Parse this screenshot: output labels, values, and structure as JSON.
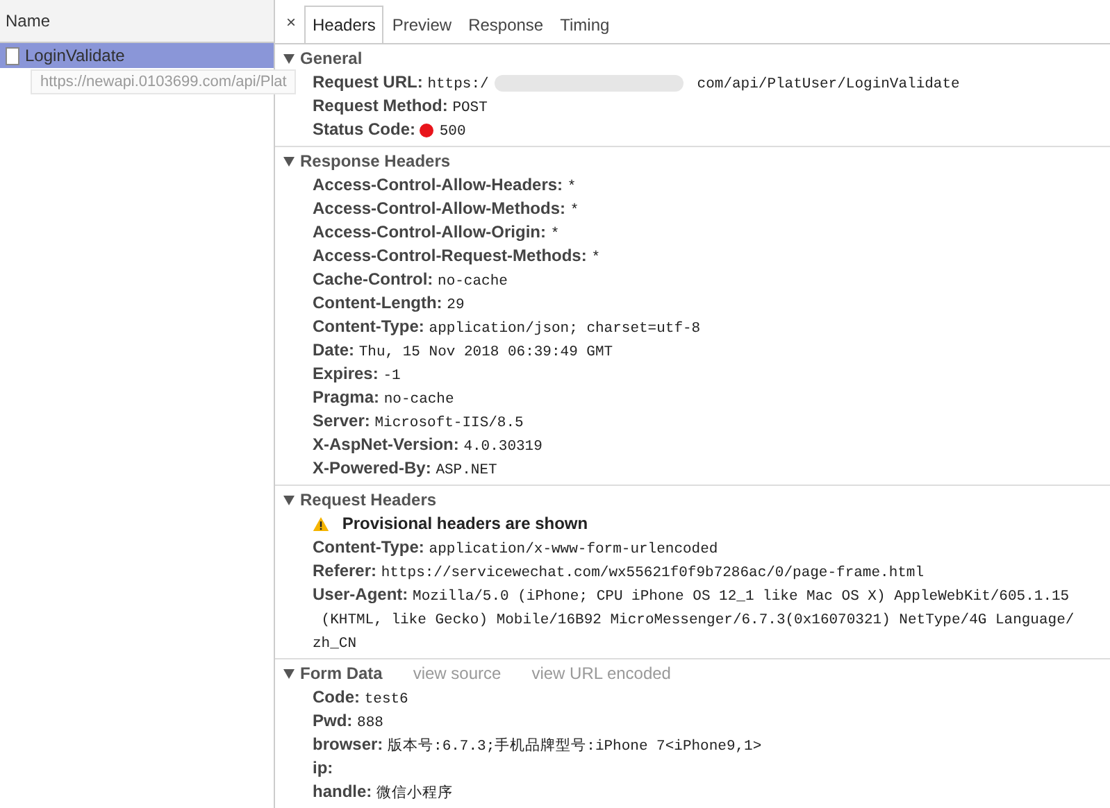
{
  "requests": {
    "column_header": "Name",
    "items": [
      {
        "name": "LoginValidate",
        "selected": true
      }
    ],
    "tooltip": "https://newapi.0103699.com/api/Plat"
  },
  "detail_tabs": {
    "close": "×",
    "tabs": [
      {
        "label": "Headers",
        "selected": true
      },
      {
        "label": "Preview",
        "selected": false
      },
      {
        "label": "Response",
        "selected": false
      },
      {
        "label": "Timing",
        "selected": false
      }
    ]
  },
  "sections": [
    {
      "title": "General",
      "expanded": true,
      "rows": [
        {
          "kind": "redacted",
          "label": "Request URL:",
          "value": "https:/",
          "value_end": "com/api/PlatUser/LoginValidate"
        },
        {
          "kind": "text",
          "label": "Request Method:",
          "value": "POST"
        },
        {
          "kind": "status",
          "label": "Status Code:",
          "value": "500",
          "color": "#e8141b"
        }
      ]
    },
    {
      "title": "Response Headers",
      "expanded": true,
      "rows": [
        {
          "kind": "text",
          "label": "Access-Control-Allow-Headers:",
          "value": "*"
        },
        {
          "kind": "text",
          "label": "Access-Control-Allow-Methods:",
          "value": "*"
        },
        {
          "kind": "text",
          "label": "Access-Control-Allow-Origin:",
          "value": "*"
        },
        {
          "kind": "text",
          "label": "Access-Control-Request-Methods:",
          "value": "*"
        },
        {
          "kind": "text",
          "label": "Cache-Control:",
          "value": "no-cache"
        },
        {
          "kind": "text",
          "label": "Content-Length:",
          "value": "29"
        },
        {
          "kind": "text",
          "label": "Content-Type:",
          "value": "application/json; charset=utf-8"
        },
        {
          "kind": "text",
          "label": "Date:",
          "value": "Thu, 15 Nov 2018 06:39:49 GMT"
        },
        {
          "kind": "text",
          "label": "Expires:",
          "value": "-1"
        },
        {
          "kind": "text",
          "label": "Pragma:",
          "value": "no-cache"
        },
        {
          "kind": "text",
          "label": "Server:",
          "value": "Microsoft-IIS/8.5"
        },
        {
          "kind": "text",
          "label": "X-AspNet-Version:",
          "value": "4.0.30319"
        },
        {
          "kind": "text",
          "label": "X-Powered-By:",
          "value": "ASP.NET"
        }
      ]
    },
    {
      "title": "Request Headers",
      "expanded": true,
      "rows": [
        {
          "kind": "warning",
          "label": "Provisional headers are shown"
        },
        {
          "kind": "text",
          "label": "Content-Type:",
          "value": "application/x-www-form-urlencoded"
        },
        {
          "kind": "text",
          "label": "Referer:",
          "value": "https://servicewechat.com/wx55621f0f9b7286ac/0/page-frame.html"
        },
        {
          "kind": "wrapped",
          "label": "User-Agent:",
          "value_lines": [
            "Mozilla/5.0 (iPhone; CPU iPhone OS 12_1 like Mac OS X) AppleWebKit/605.1.15",
            " (KHTML, like Gecko) Mobile/16B92 MicroMessenger/6.7.3(0x16070321) NetType/4G Language/",
            "zh_CN"
          ]
        }
      ]
    },
    {
      "title": "Form Data",
      "expanded": true,
      "links": [
        "view source",
        "view URL encoded"
      ],
      "rows": [
        {
          "kind": "text",
          "label": "Code:",
          "value": "test6"
        },
        {
          "kind": "text",
          "label": "Pwd:",
          "value": "888"
        },
        {
          "kind": "text",
          "label": "browser:",
          "value": "版本号:6.7.3;手机品牌型号:iPhone 7<iPhone9,1>"
        },
        {
          "kind": "text",
          "label": "ip:"
        },
        {
          "kind": "text",
          "label": "handle:",
          "value": "微信小程序"
        }
      ]
    }
  ]
}
